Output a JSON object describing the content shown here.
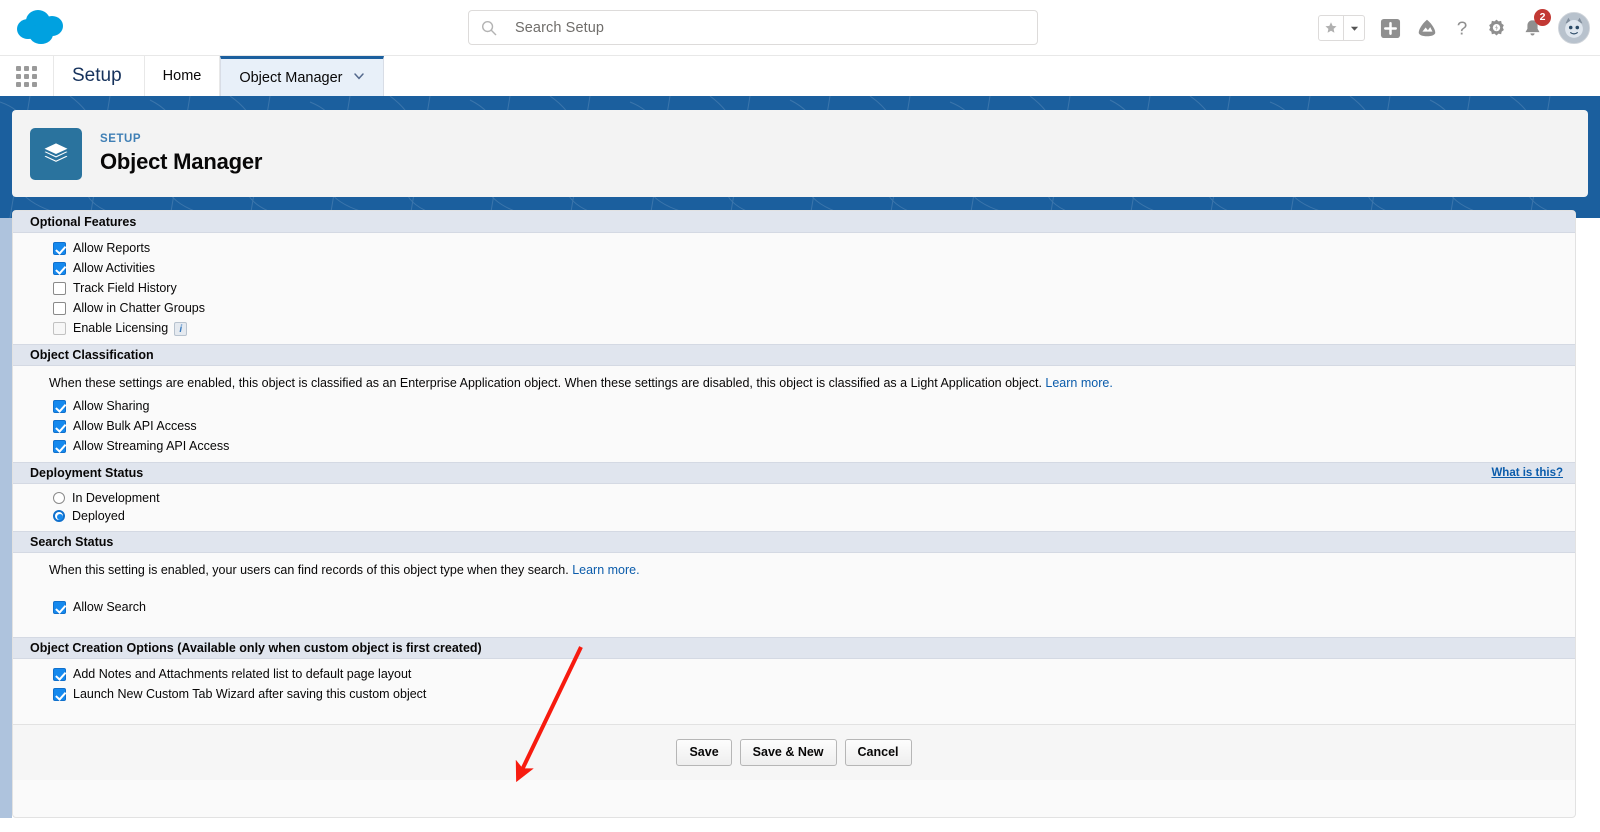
{
  "global_header": {
    "logo": "salesforce-cloud-logo",
    "search": {
      "placeholder": "Search Setup",
      "value": "",
      "icon": "search-icon"
    },
    "icons": [
      {
        "name": "favorites-star-icon",
        "glyph": "star"
      },
      {
        "name": "favorites-dropdown-icon",
        "glyph": "caret-down"
      },
      {
        "name": "global-actions-icon",
        "glyph": "plus"
      },
      {
        "name": "guidance-center-icon",
        "glyph": "mountain"
      },
      {
        "name": "help-icon",
        "glyph": "question-mark"
      },
      {
        "name": "setup-gear-icon",
        "glyph": "gear"
      },
      {
        "name": "notifications-bell-icon",
        "glyph": "bell"
      },
      {
        "name": "user-avatar",
        "glyph": "avatar"
      }
    ],
    "notification_count": "2"
  },
  "setup_nav": {
    "app_launcher_label": "app-launcher-waffle",
    "setup_label": "Setup",
    "tabs": [
      {
        "label": "Home",
        "active": false,
        "has_caret": false
      },
      {
        "label": "Object Manager",
        "active": true,
        "has_caret": true
      }
    ]
  },
  "page_header": {
    "eyebrow": "SETUP",
    "title": "Object Manager",
    "icon": "layers-stack-icon"
  },
  "sections": [
    {
      "id": "optional-features",
      "title": "Optional Features",
      "right_link": null,
      "description": null,
      "checkboxes": [
        {
          "label": "Allow Reports",
          "checked": true,
          "disabled": false,
          "info": false
        },
        {
          "label": "Allow Activities",
          "checked": true,
          "disabled": false,
          "info": false
        },
        {
          "label": "Track Field History",
          "checked": false,
          "disabled": false,
          "info": false
        },
        {
          "label": "Allow in Chatter Groups",
          "checked": false,
          "disabled": false,
          "info": false
        },
        {
          "label": "Enable Licensing",
          "checked": false,
          "disabled": true,
          "info": true
        }
      ]
    },
    {
      "id": "object-classification",
      "title": "Object Classification",
      "right_link": null,
      "description_parts": {
        "text": "When these settings are enabled, this object is classified as an Enterprise Application object. When these settings are disabled, this object is classified as a Light Application object. ",
        "link": "Learn more."
      },
      "checkboxes": [
        {
          "label": "Allow Sharing",
          "checked": true,
          "disabled": false,
          "info": false
        },
        {
          "label": "Allow Bulk API Access",
          "checked": true,
          "disabled": false,
          "info": false
        },
        {
          "label": "Allow Streaming API Access",
          "checked": true,
          "disabled": false,
          "info": false
        }
      ]
    },
    {
      "id": "deployment-status",
      "title": "Deployment Status",
      "right_link": "What is this?",
      "radios": [
        {
          "label": "In Development",
          "selected": false
        },
        {
          "label": "Deployed",
          "selected": true
        }
      ]
    },
    {
      "id": "search-status",
      "title": "Search Status",
      "right_link": null,
      "description_parts": {
        "text": "When this setting is enabled, your users can find records of this object type when they search. ",
        "link": "Learn more."
      },
      "checkboxes": [
        {
          "label": "Allow Search",
          "checked": true,
          "disabled": false,
          "info": false
        }
      ]
    },
    {
      "id": "object-creation-options",
      "title": "Object Creation Options (Available only when custom object is first created)",
      "right_link": null,
      "description": null,
      "checkboxes": [
        {
          "label": "Add Notes and Attachments related list to default page layout",
          "checked": true,
          "disabled": false,
          "info": false
        },
        {
          "label": "Launch New Custom Tab Wizard after saving this custom object",
          "checked": true,
          "disabled": false,
          "info": false
        }
      ]
    }
  ],
  "buttons": [
    {
      "label": "Save",
      "name": "save-button"
    },
    {
      "label": "Save & New",
      "name": "save-and-new-button"
    },
    {
      "label": "Cancel",
      "name": "cancel-button"
    }
  ],
  "annotation": {
    "type": "arrow",
    "color": "#f71b0f",
    "points_to": "save-button"
  },
  "colors": {
    "banner_blue": "#1b5f9e",
    "section_header": "#e0e5ee",
    "checkbox_blue": "#1589ee",
    "link_blue": "#0b5cab",
    "badge_red": "#c23934",
    "annotation_red": "#f71b0f"
  }
}
